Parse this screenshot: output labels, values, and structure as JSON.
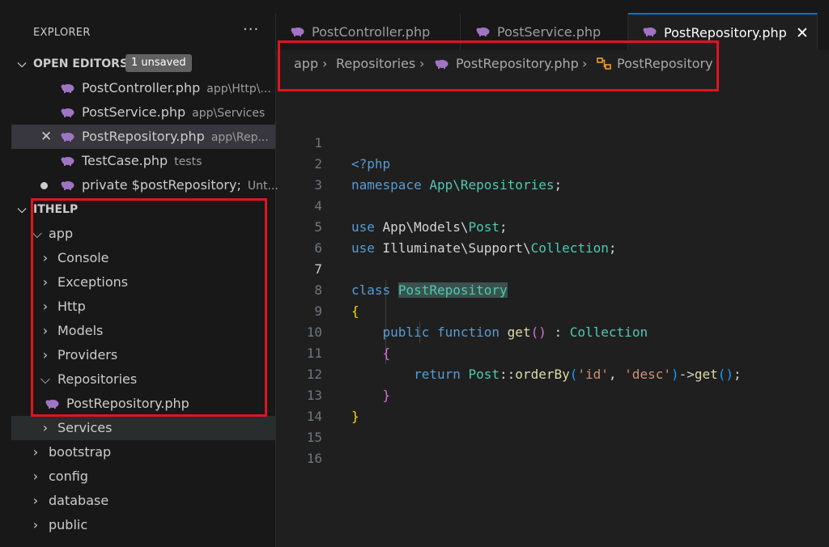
{
  "colors": {
    "accent": "#0078d4",
    "highlight_box": "#e0141e",
    "php_icon": "#a074c4",
    "keyword": "#569cd6",
    "class": "#4ec9b0",
    "function": "#dcdcaa",
    "string": "#ce9178"
  },
  "sidebar": {
    "title": "EXPLORER",
    "more_label": "···",
    "open_editors": {
      "label": "OPEN EDITORS",
      "badge": "1 unsaved",
      "items": [
        {
          "name": "PostController.php",
          "path": "app\\Http\\..."
        },
        {
          "name": "PostService.php",
          "path": "app\\Services"
        },
        {
          "name": "PostRepository.php",
          "path": "app\\Rep..."
        },
        {
          "name": "TestCase.php",
          "path": "tests"
        },
        {
          "name": "private $postRepository;",
          "path": "Unt..."
        }
      ]
    },
    "project": {
      "label": "ITHELP",
      "tree": [
        {
          "label": "app",
          "expanded": true
        },
        {
          "label": "Console",
          "expanded": false
        },
        {
          "label": "Exceptions",
          "expanded": false
        },
        {
          "label": "Http",
          "expanded": false
        },
        {
          "label": "Models",
          "expanded": false
        },
        {
          "label": "Providers",
          "expanded": false
        },
        {
          "label": "Repositories",
          "expanded": true
        },
        {
          "label": "PostRepository.php",
          "icon": "php-elephant-icon"
        },
        {
          "label": "Services",
          "expanded": false
        },
        {
          "label": "bootstrap",
          "expanded": false
        },
        {
          "label": "config",
          "expanded": false
        },
        {
          "label": "database",
          "expanded": false
        },
        {
          "label": "public",
          "expanded": false
        }
      ]
    }
  },
  "tabs": [
    {
      "label": "PostController.php",
      "active": false
    },
    {
      "label": "PostService.php",
      "active": false
    },
    {
      "label": "PostRepository.php",
      "active": true
    }
  ],
  "breadcrumb": {
    "parts": [
      "app",
      "Repositories",
      "PostRepository.php",
      "PostRepository"
    ]
  },
  "editor": {
    "current_line": 7,
    "line_numbers": [
      "1",
      "2",
      "3",
      "4",
      "5",
      "6",
      "7",
      "8",
      "9",
      "10",
      "11",
      "12",
      "13",
      "14",
      "15",
      "16"
    ],
    "code": {
      "l1_tag": "<?php",
      "l2_kw": "namespace",
      "l2_ns": "App\\Repositories",
      "l2_end": ";",
      "l4_kw": "use",
      "l4_ns": "App\\Models\\",
      "l4_cls": "Post",
      "l4_end": ";",
      "l5_kw": "use",
      "l5_ns": "Illuminate\\Support\\",
      "l5_cls": "Collection",
      "l5_end": ";",
      "l7_kw": "class",
      "l7_cls": "PostRepository",
      "l8_brace": "{",
      "l9_kw1": "public",
      "l9_kw2": "function",
      "l9_fn": "get",
      "l9_par": "()",
      "l9_colon": " : ",
      "l9_cls": "Collection",
      "l10_brace": "{",
      "l11_kw": "return",
      "l11_cls": "Post",
      "l11_op1": "::",
      "l11_fn1": "orderBy",
      "l11_p1": "(",
      "l11_s1": "'id'",
      "l11_comma": ", ",
      "l11_s2": "'desc'",
      "l11_p2": ")",
      "l11_op2": "->",
      "l11_fn2": "get",
      "l11_p3": "()",
      "l11_end": ";",
      "l12_brace": "}",
      "l13_brace": "}"
    }
  }
}
